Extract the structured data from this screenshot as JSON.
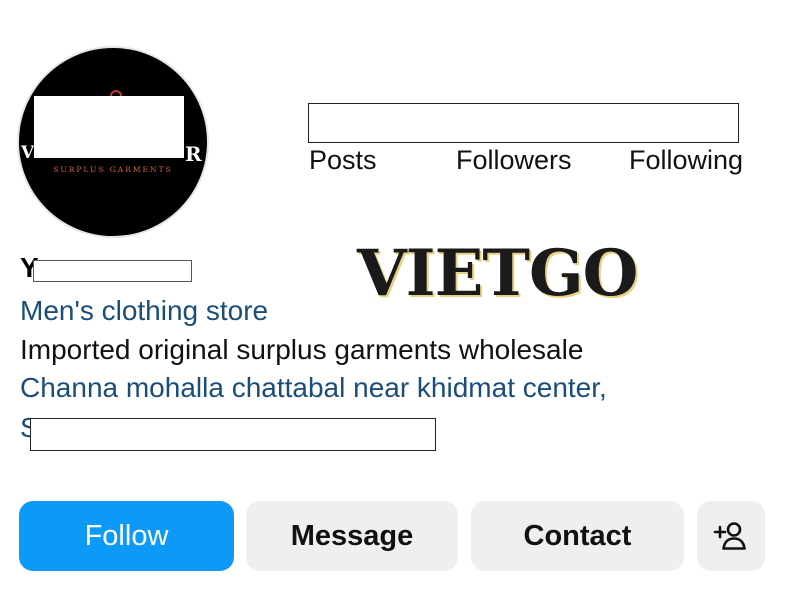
{
  "profile": {
    "avatar_tagline": "SURPLUS GARMENTS",
    "avatar_letter_left": "V",
    "avatar_letter_right": "R",
    "name_visible": "Y",
    "category": "Men's clothing store",
    "bio_line": "Imported original surplus garments wholesale",
    "address_line": "Channa mohalla chattabal near khidmat center,",
    "address_line2_start": "S"
  },
  "stats": {
    "posts_label": "Posts",
    "followers_label": "Followers",
    "following_label": "Following"
  },
  "watermark": "VIETGO",
  "actions": {
    "follow_label": "Follow",
    "message_label": "Message",
    "contact_label": "Contact",
    "add_person_icon": "add-person-icon"
  },
  "colors": {
    "follow_bg": "#0d99f8",
    "secondary_bg": "#efefef",
    "link": "#1a4d7a"
  }
}
